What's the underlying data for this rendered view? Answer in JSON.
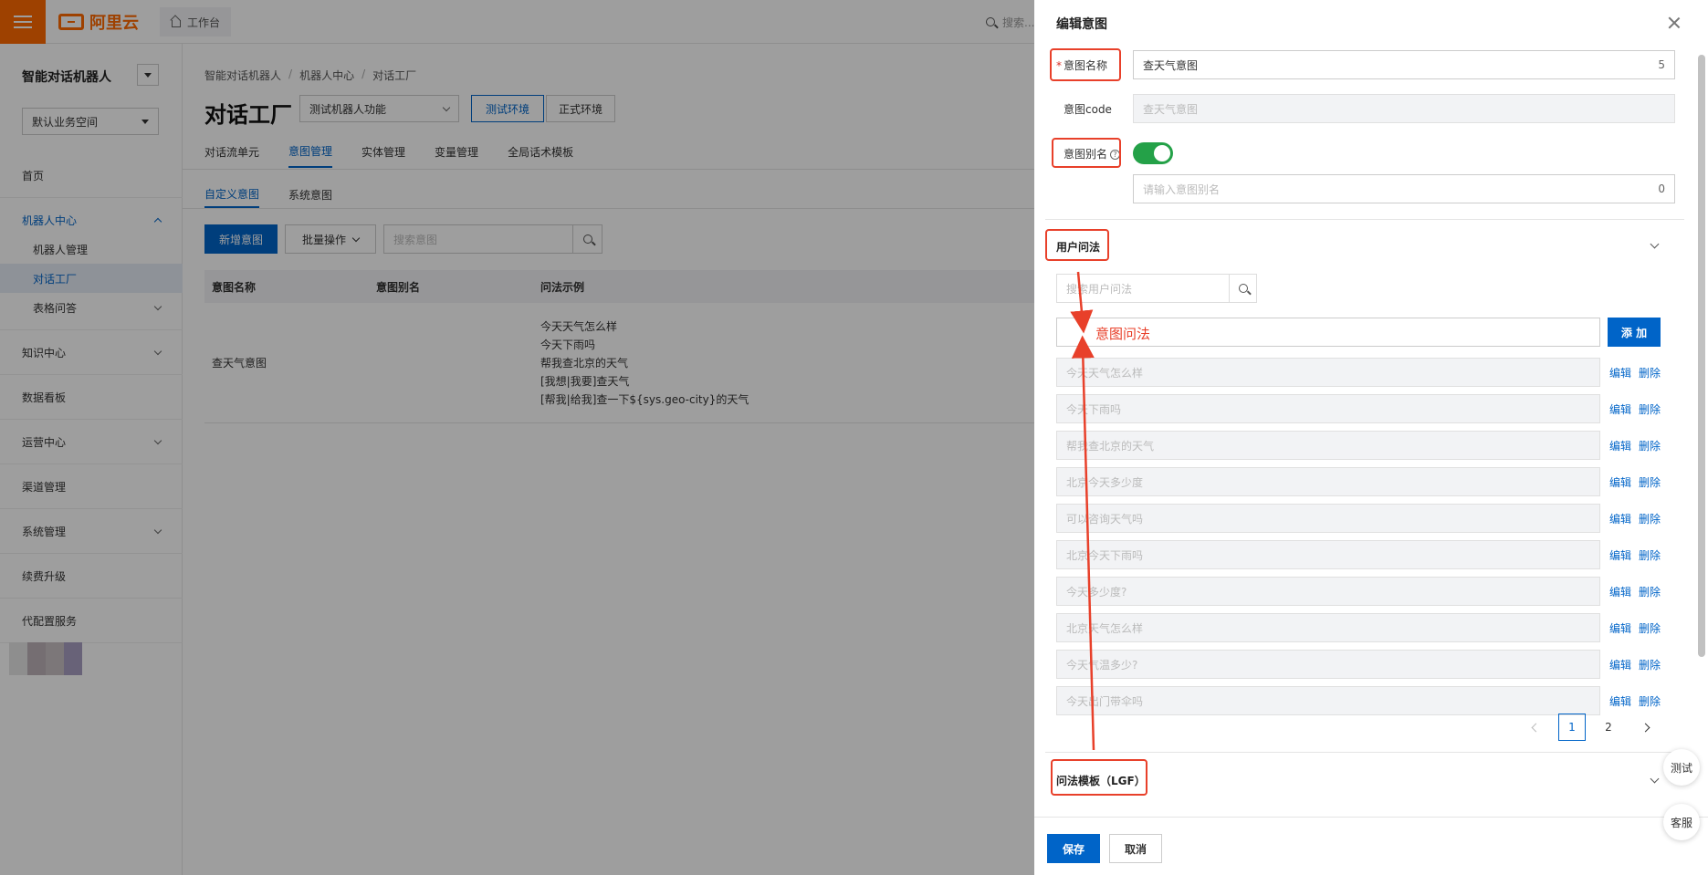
{
  "topbar": {
    "logo_text": "阿里云",
    "workbench_label": "工作台",
    "search_placeholder": "搜索..."
  },
  "sidebar": {
    "title": "智能对话机器人",
    "space_select": "默认业务空间",
    "items": [
      {
        "label": "首页"
      },
      {
        "label": "机器人中心",
        "sub": [
          {
            "label": "机器人管理"
          },
          {
            "label": "对话工厂"
          },
          {
            "label": "表格问答"
          }
        ]
      },
      {
        "label": "知识中心"
      },
      {
        "label": "数据看板"
      },
      {
        "label": "运营中心"
      },
      {
        "label": "渠道管理"
      },
      {
        "label": "系统管理"
      },
      {
        "label": "续费升级"
      },
      {
        "label": "代配置服务"
      }
    ]
  },
  "main": {
    "breadcrumb": [
      "智能对话机器人",
      "机器人中心",
      "对话工厂"
    ],
    "page_title": "对话工厂",
    "robot_select": "测试机器人功能",
    "env_test": "测试环境",
    "env_prod": "正式环境",
    "tabs": [
      "对话流单元",
      "意图管理",
      "实体管理",
      "变量管理",
      "全局话术模板"
    ],
    "subtabs": [
      "自定义意图",
      "系统意图"
    ],
    "btn_new": "新增意图",
    "btn_batch": "批量操作",
    "search_placeholder": "搜索意图",
    "table": {
      "headers": [
        "意图名称",
        "意图别名",
        "问法示例"
      ],
      "rows": [
        {
          "name": "查天气意图",
          "alias": "",
          "examples": [
            "今天天气怎么样",
            "今天下雨吗",
            "帮我查北京的天气",
            "[我想|我要]查天气",
            "[帮我|给我]查一下${sys.geo-city}的天气"
          ]
        }
      ]
    }
  },
  "drawer": {
    "title": "编辑意图",
    "intent_name_label": "意图名称",
    "intent_name_value": "查天气意图",
    "intent_name_count": "5",
    "intent_code_label": "意图code",
    "intent_code_value": "查天气意图",
    "alias_label": "意图别名",
    "alias_placeholder": "请输入意图别名",
    "alias_count": "0",
    "user_questions_title": "用户问法",
    "question_search_placeholder": "搜索用户问法",
    "btn_add": "添 加",
    "questions": [
      "今天天气怎么样",
      "今天下雨吗",
      "帮我查北京的天气",
      "北京今天多少度",
      "可以咨询天气吗",
      "北京今天下雨吗",
      "今天多少度?",
      "北京天气怎么样",
      "今天气温多少?",
      "今天出门带伞吗"
    ],
    "edit_label": "编辑",
    "delete_label": "删除",
    "pages": [
      "1",
      "2"
    ],
    "lgf_title": "问法模板（LGF）",
    "btn_save": "保存",
    "btn_cancel": "取消"
  },
  "floating": {
    "test": "测试",
    "service": "客服"
  },
  "annotation": {
    "label": "意图问法",
    "color": "#e8402a"
  }
}
